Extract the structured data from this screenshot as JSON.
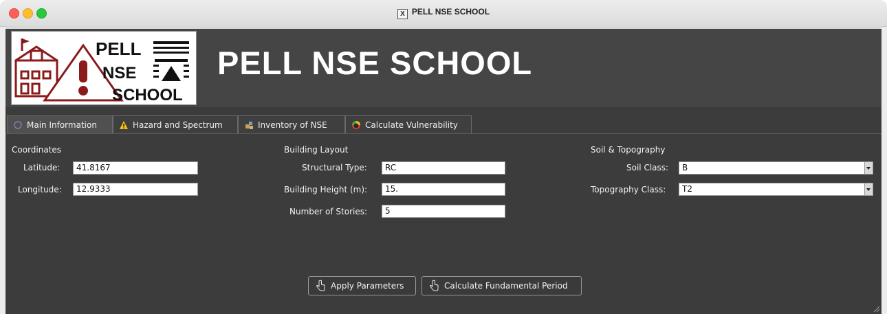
{
  "window": {
    "title": "PELL NSE SCHOOL"
  },
  "header": {
    "title": "PELL NSE SCHOOL",
    "logo": {
      "line1": "PELL",
      "line2": "NSE",
      "line3": "SCHOOL"
    }
  },
  "tabs": [
    {
      "label": "Main Information",
      "icon": "circle-icon",
      "active": true
    },
    {
      "label": "Hazard and Spectrum",
      "icon": "warning-icon"
    },
    {
      "label": "Inventory of NSE",
      "icon": "inventory-icon"
    },
    {
      "label": "Calculate Vulnerability",
      "icon": "gauge-icon"
    }
  ],
  "coordinates": {
    "heading": "Coordinates",
    "latitude_label": "Latitude:",
    "latitude_value": "41.8167",
    "longitude_label": "Longitude:",
    "longitude_value": "12.9333"
  },
  "layout": {
    "heading": "Building Layout",
    "structural_type_label": "Structural Type:",
    "structural_type_value": "RC",
    "height_label": "Building Height (m):",
    "height_value": "15.",
    "stories_label": "Number of Stories:",
    "stories_value": "5"
  },
  "soil": {
    "heading": "Soil & Topography",
    "soil_class_label": "Soil Class:",
    "soil_class_value": "B",
    "topography_label": "Topography Class:",
    "topography_value": "T2"
  },
  "buttons": {
    "apply": "Apply Parameters",
    "period": "Calculate Fundamental Period"
  },
  "colors": {
    "logo_red": "#8b1a1a",
    "accent_yellow": "#f4c20d"
  }
}
